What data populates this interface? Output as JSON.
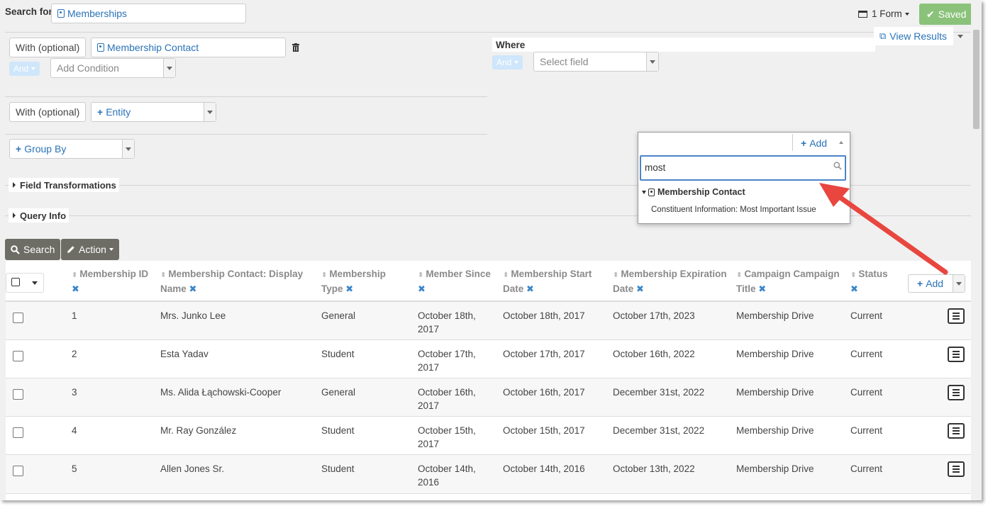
{
  "search_for": {
    "label": "Search for",
    "entity": "Memberships"
  },
  "toolbar": {
    "forms": "1 Form",
    "saved": "Saved",
    "view_results": "View Results"
  },
  "with1": {
    "label": "With (optional)",
    "entity": "Membership Contact",
    "and": "And",
    "add_condition_placeholder": "Add Condition"
  },
  "where": {
    "title": "Where",
    "and": "And",
    "select_placeholder": "Select field"
  },
  "with2": {
    "label": "With (optional)",
    "entity": "Entity"
  },
  "group_by": "Group By",
  "sections": {
    "field_transformations": "Field Transformations",
    "query_info": "Query Info"
  },
  "actions": {
    "search": "Search",
    "action": "Action",
    "add": "Add"
  },
  "dropdown": {
    "add": "Add",
    "search_value": "most",
    "group": "Membership Contact",
    "item": "Constituent Information: Most Important Issue"
  },
  "table": {
    "headers": [
      {
        "line1": "Membership ID",
        "line2": ""
      },
      {
        "line1": "Membership Contact: Display",
        "line2": "Name"
      },
      {
        "line1": "Membership",
        "line2": "Type"
      },
      {
        "line1": "Member Since",
        "line2": ""
      },
      {
        "line1": "Membership Start",
        "line2": "Date"
      },
      {
        "line1": "Membership Expiration",
        "line2": "Date"
      },
      {
        "line1": "Campaign Campaign",
        "line2": "Title"
      },
      {
        "line1": "Status",
        "line2": ""
      }
    ],
    "rows": [
      {
        "id": "1",
        "name": "Mrs. Junko Lee",
        "type": "General",
        "since1": "October 18th,",
        "since2": "2017",
        "start": "October 18th, 2017",
        "expiration": "October 17th, 2023",
        "campaign": "Membership Drive",
        "status": "Current"
      },
      {
        "id": "2",
        "name": "Esta Yadav",
        "type": "Student",
        "since1": "October 17th,",
        "since2": "2017",
        "start": "October 17th, 2017",
        "expiration": "October 16th, 2022",
        "campaign": "Membership Drive",
        "status": "Current"
      },
      {
        "id": "3",
        "name": "Ms. Alida Łąchowski-Cooper",
        "type": "General",
        "since1": "October 16th,",
        "since2": "2017",
        "start": "October 16th, 2017",
        "expiration": "December 31st, 2022",
        "campaign": "Membership Drive",
        "status": "Current"
      },
      {
        "id": "4",
        "name": "Mr. Ray González",
        "type": "Student",
        "since1": "October 15th,",
        "since2": "2017",
        "start": "October 15th, 2017",
        "expiration": "December 31st, 2022",
        "campaign": "Membership Drive",
        "status": "Current"
      },
      {
        "id": "5",
        "name": "Allen Jones Sr.",
        "type": "Student",
        "since1": "October 14th,",
        "since2": "2016",
        "start": "October 14th, 2016",
        "expiration": "October 13th, 2022",
        "campaign": "Membership Drive",
        "status": "Current"
      }
    ]
  },
  "colors": {
    "link": "#2a73b8",
    "saved": "#8ac27a",
    "dark_button": "#6d6d66",
    "arrow": "#e8463f"
  }
}
